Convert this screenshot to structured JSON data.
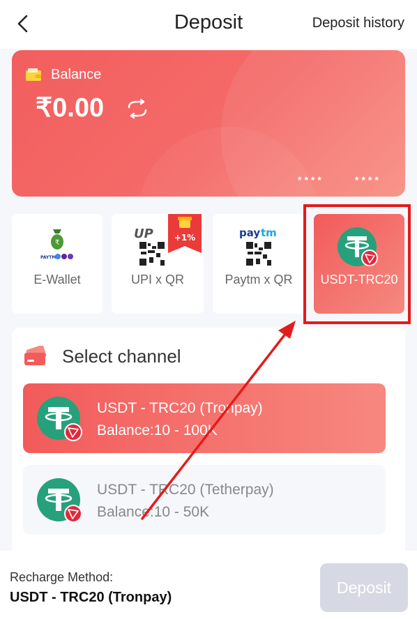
{
  "header": {
    "title": "Deposit",
    "history_label": "Deposit history"
  },
  "balance_card": {
    "label": "Balance",
    "amount": "₹0.00",
    "mask_left": "****",
    "mask_right": "****"
  },
  "methods": [
    {
      "label": "E-Wallet",
      "icon": "wallet-bag-icon"
    },
    {
      "label": "UPI x QR",
      "icon": "upi-qr-icon",
      "badge": "+1%"
    },
    {
      "label": "Paytm x QR",
      "icon": "paytm-qr-icon"
    },
    {
      "label": "USDT-TRC20",
      "icon": "tether-icon",
      "selected": true
    }
  ],
  "channel_section": {
    "title": "Select channel",
    "channels": [
      {
        "name": "USDT - TRC20 (Tronpay)",
        "balance": "Balance:10 - 100K",
        "selected": true
      },
      {
        "name": "USDT - TRC20 (Tetherpay)",
        "balance": "Balance:10 - 50K",
        "selected": false
      }
    ]
  },
  "footer": {
    "recharge_label": "Recharge Method:",
    "recharge_value": "USDT - TRC20 (Tronpay)",
    "deposit_label": "Deposit"
  },
  "colors": {
    "accent": "#f25b5b",
    "tether_green": "#26a17b",
    "tron_red": "#e4273a",
    "highlight": "#e51a1a"
  }
}
